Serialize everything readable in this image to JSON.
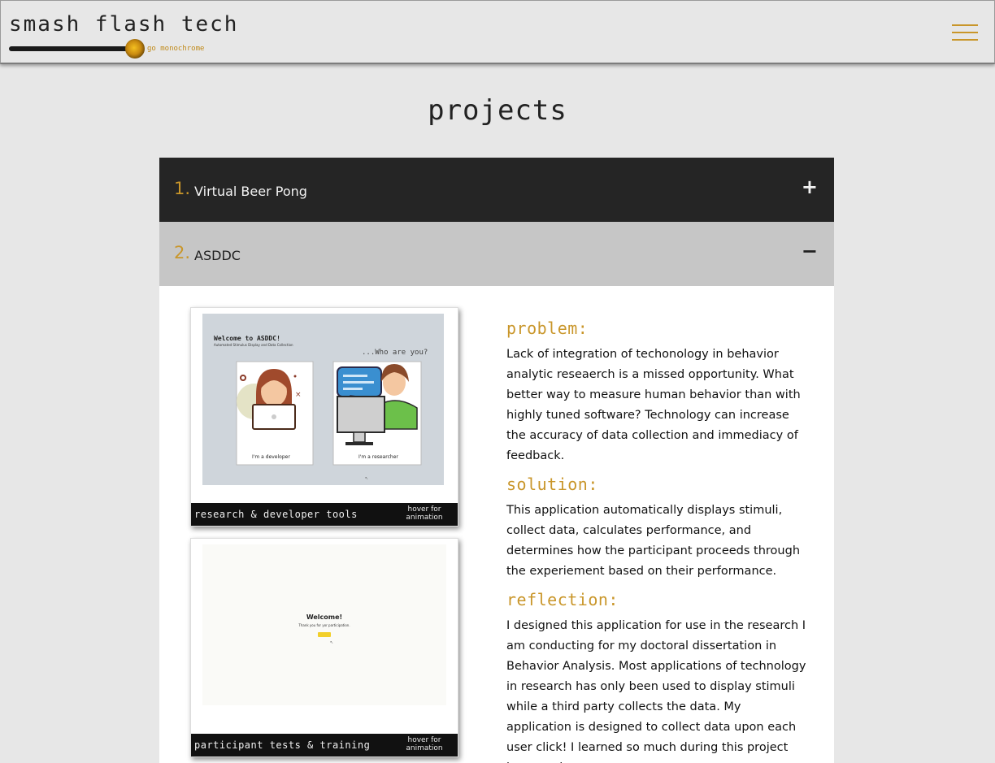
{
  "header": {
    "brand_title": "smash flash tech",
    "brand_toggle_label": "go monochrome",
    "menu_icon": "hamburger-icon",
    "accent_color": "#c9962a"
  },
  "page": {
    "title": "Projects"
  },
  "accordion": {
    "items": [
      {
        "number": "1.",
        "label": "Virtual Beer Pong",
        "toggle": "+",
        "expanded": false
      },
      {
        "number": "2.",
        "label": "ASDDC",
        "toggle": "−",
        "expanded": true
      }
    ]
  },
  "asddc": {
    "cards": [
      {
        "caption": "Research & Developer Tools",
        "hint": "hover for animation",
        "screen": {
          "heading": "Welcome to ASDDC!",
          "subheading": "Automated Stimulus Display and Data Collection",
          "question": "...Who are you?",
          "option_developer": "I'm a developer",
          "option_researcher": "I'm a researcher"
        }
      },
      {
        "caption": "Participant Tests & Training",
        "hint": "hover for animation",
        "screen": {
          "heading": "Welcome!",
          "subheading": "Thank you for yor participation."
        }
      }
    ],
    "sections": [
      {
        "heading": "Problem:",
        "text": "Lack of integration of techonology in behavior analytic reseaerch is a missed opportunity. What better way to measure human behavior than with highly tuned software? Technology can increase the accuracy of data collection and immediacy of feedback."
      },
      {
        "heading": "Solution:",
        "text": "This application automatically displays stimuli, collect data, calculates performance, and determines how the participant proceeds through the experiement based on their performance."
      },
      {
        "heading": "Reflection:",
        "text": "I designed this application for use in the research I am conducting for my doctoral dissertation in Behavior Analysis. Most applications of technology in research has only been used to display stimuli while a third party collects the data. My application is designed to collect data upon each user click! I learned so much during this project because it"
      }
    ]
  }
}
